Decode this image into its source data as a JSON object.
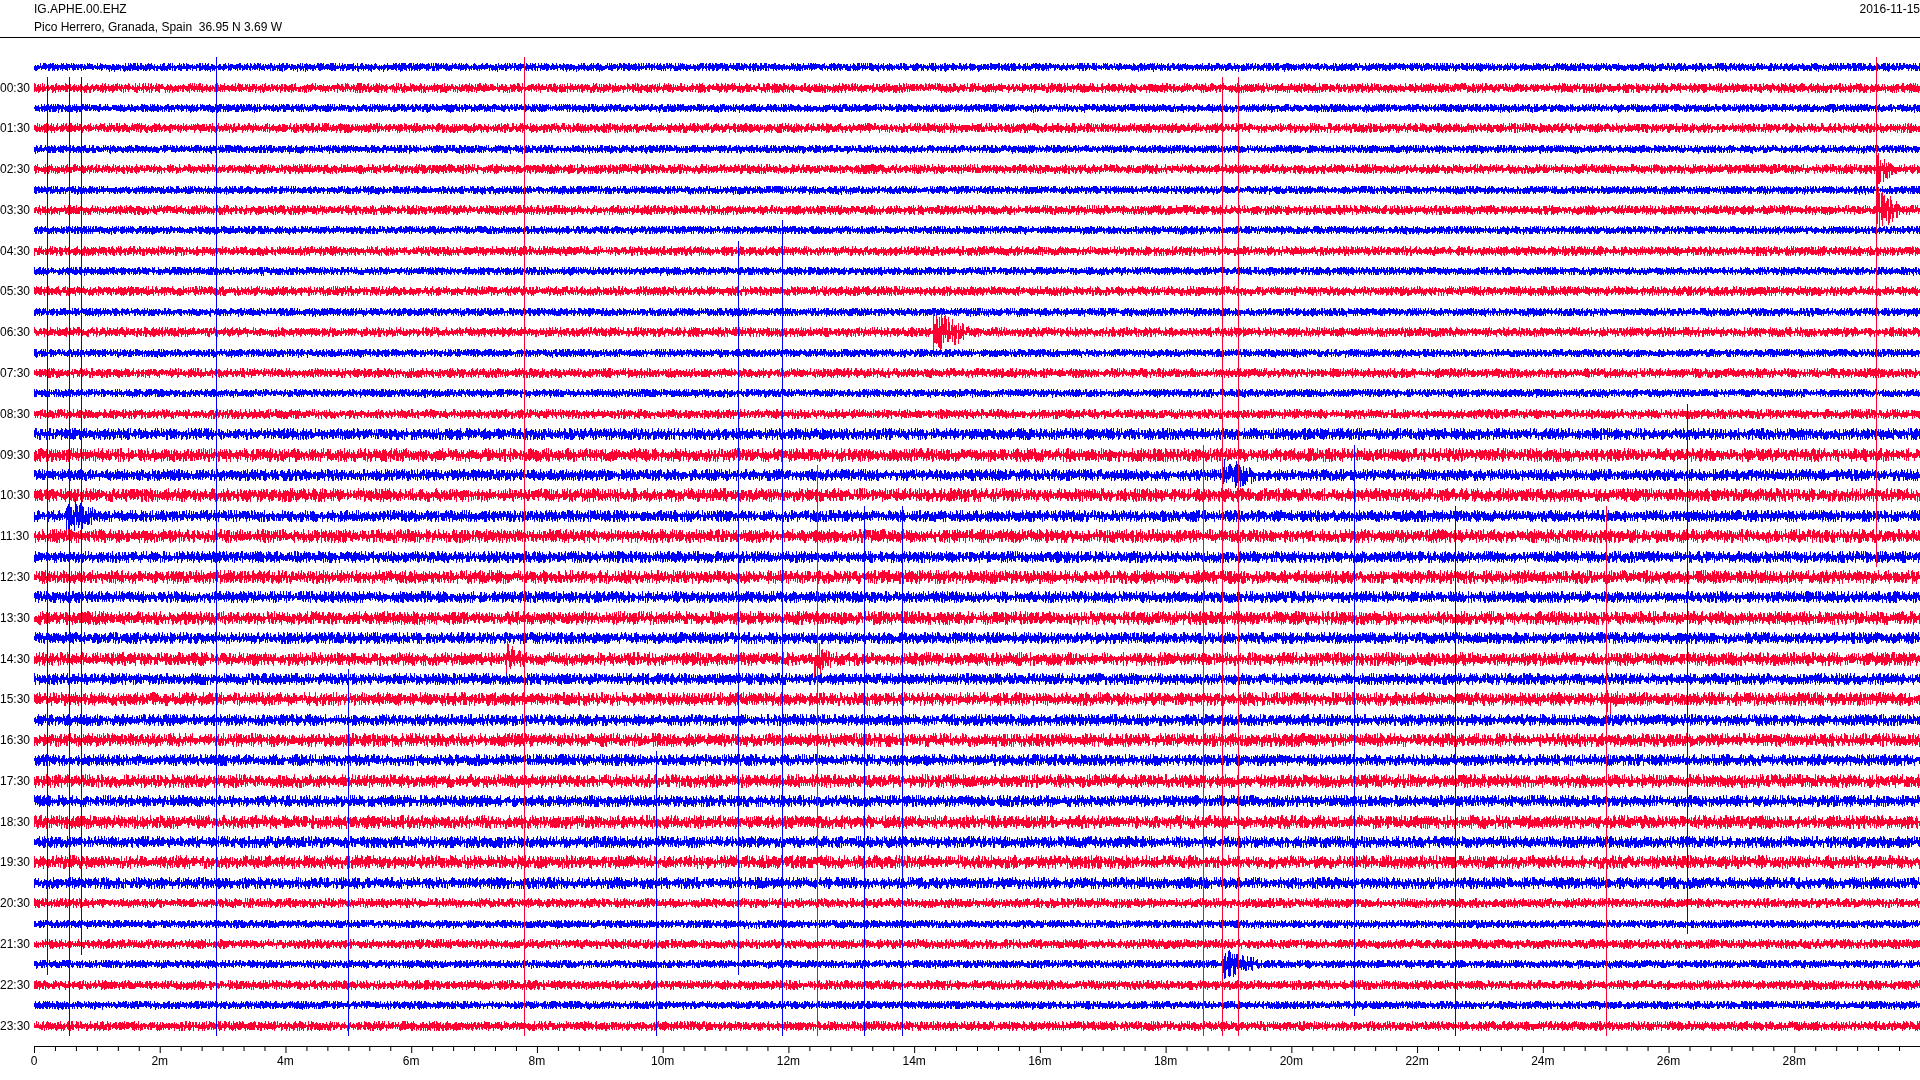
{
  "header": {
    "station": "IG.APHE.00.EHZ",
    "location": "Pico Herrero, Granada, Spain  36.95 N 3.69 W",
    "date": "2016-11-15"
  },
  "traces": [
    {
      "color": "#0000ff"
    },
    {
      "color": "#ff0033",
      "label": "00:30"
    },
    {
      "color": "#0000ff"
    },
    {
      "color": "#ff0033",
      "label": "01:30"
    },
    {
      "color": "#0000ff"
    },
    {
      "color": "#ff0033",
      "label": "02:30"
    },
    {
      "color": "#0000ff"
    },
    {
      "color": "#ff0033",
      "label": "03:30"
    },
    {
      "color": "#0000ff"
    },
    {
      "color": "#ff0033",
      "label": "04:30"
    },
    {
      "color": "#0000ff"
    },
    {
      "color": "#ff0033",
      "label": "05:30"
    },
    {
      "color": "#0000ff"
    },
    {
      "color": "#ff0033",
      "label": "06:30"
    },
    {
      "color": "#0000ff"
    },
    {
      "color": "#ff0033",
      "label": "07:30"
    },
    {
      "color": "#0000ff"
    },
    {
      "color": "#ff0033",
      "label": "08:30"
    },
    {
      "color": "#0000ff"
    },
    {
      "color": "#ff0033",
      "label": "09:30"
    },
    {
      "color": "#0000ff"
    },
    {
      "color": "#ff0033",
      "label": "10:30"
    },
    {
      "color": "#0000ff"
    },
    {
      "color": "#ff0033",
      "label": "11:30"
    },
    {
      "color": "#0000ff"
    },
    {
      "color": "#ff0033",
      "label": "12:30"
    },
    {
      "color": "#0000ff"
    },
    {
      "color": "#ff0033",
      "label": "13:30"
    },
    {
      "color": "#0000ff"
    },
    {
      "color": "#ff0033",
      "label": "14:30"
    },
    {
      "color": "#0000ff"
    },
    {
      "color": "#ff0033",
      "label": "15:30"
    },
    {
      "color": "#0000ff"
    },
    {
      "color": "#ff0033",
      "label": "16:30"
    },
    {
      "color": "#0000ff"
    },
    {
      "color": "#ff0033",
      "label": "17:30"
    },
    {
      "color": "#0000ff"
    },
    {
      "color": "#ff0033",
      "label": "18:30"
    },
    {
      "color": "#0000ff"
    },
    {
      "color": "#ff0033",
      "label": "19:30"
    },
    {
      "color": "#0000ff"
    },
    {
      "color": "#ff0033",
      "label": "20:30"
    },
    {
      "color": "#0000ff"
    },
    {
      "color": "#ff0033",
      "label": "21:30"
    },
    {
      "color": "#0000ff"
    },
    {
      "color": "#ff0033",
      "label": "22:30"
    },
    {
      "color": "#0000ff"
    },
    {
      "color": "#ff0033",
      "label": "23:30"
    }
  ],
  "x_axis": {
    "labels": [
      "0",
      "2m",
      "4m",
      "6m",
      "8m",
      "10m",
      "12m",
      "14m",
      "16m",
      "18m",
      "20m",
      "22m",
      "24m",
      "26m",
      "28m"
    ]
  }
}
